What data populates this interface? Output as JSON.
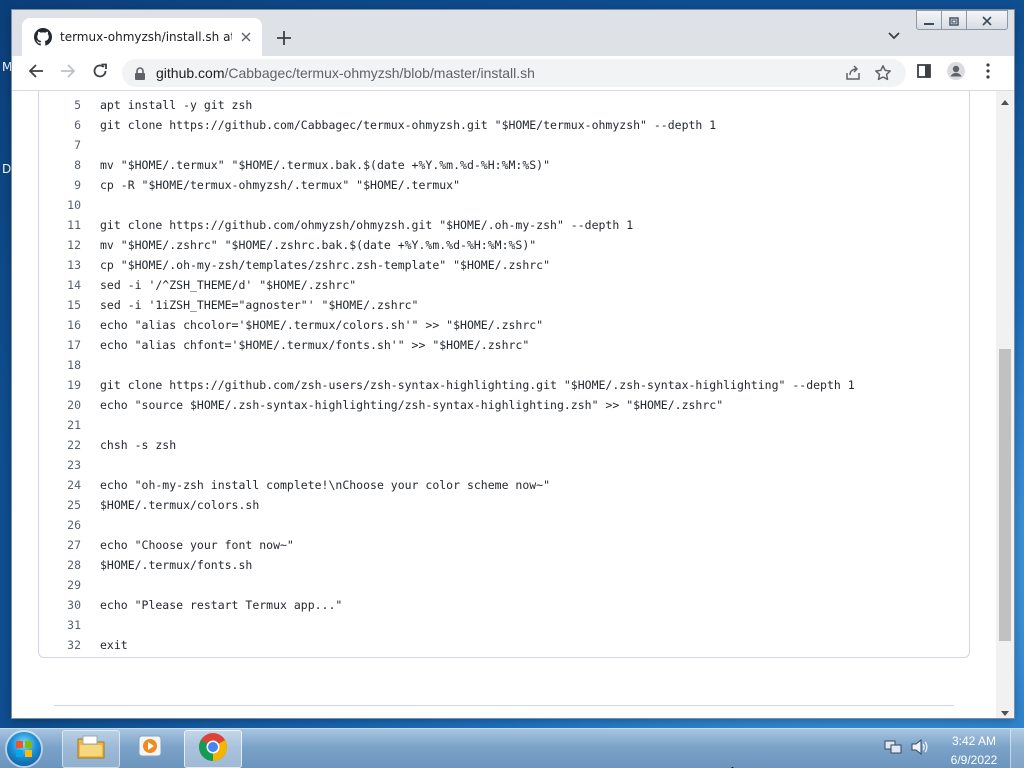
{
  "desktop": {
    "glyph_1": "M",
    "glyph_2": "D"
  },
  "tab": {
    "title": "termux-ohmyzsh/install.sh at ma"
  },
  "window_controls": {
    "minimize": "minimize-icon",
    "maximize": "maximize-icon",
    "close": "close-icon"
  },
  "toolbar": {
    "url_host": "github.com",
    "url_path": "/Cabbagec/termux-ohmyzsh/blob/master/install.sh"
  },
  "code_lines": [
    {
      "n": "5",
      "text": "apt install -y git zsh"
    },
    {
      "n": "6",
      "text": "git clone https://github.com/Cabbagec/termux-ohmyzsh.git \"$HOME/termux-ohmyzsh\" --depth 1"
    },
    {
      "n": "7",
      "text": ""
    },
    {
      "n": "8",
      "text": "mv \"$HOME/.termux\" \"$HOME/.termux.bak.$(date +%Y.%m.%d-%H:%M:%S)\""
    },
    {
      "n": "9",
      "text": "cp -R \"$HOME/termux-ohmyzsh/.termux\" \"$HOME/.termux\""
    },
    {
      "n": "10",
      "text": ""
    },
    {
      "n": "11",
      "text": "git clone https://github.com/ohmyzsh/ohmyzsh.git \"$HOME/.oh-my-zsh\" --depth 1"
    },
    {
      "n": "12",
      "text": "mv \"$HOME/.zshrc\" \"$HOME/.zshrc.bak.$(date +%Y.%m.%d-%H:%M:%S)\""
    },
    {
      "n": "13",
      "text": "cp \"$HOME/.oh-my-zsh/templates/zshrc.zsh-template\" \"$HOME/.zshrc\""
    },
    {
      "n": "14",
      "text": "sed -i '/^ZSH_THEME/d' \"$HOME/.zshrc\""
    },
    {
      "n": "15",
      "text": "sed -i '1iZSH_THEME=\"agnoster\"' \"$HOME/.zshrc\""
    },
    {
      "n": "16",
      "text": "echo \"alias chcolor='$HOME/.termux/colors.sh'\" >> \"$HOME/.zshrc\""
    },
    {
      "n": "17",
      "text": "echo \"alias chfont='$HOME/.termux/fonts.sh'\" >> \"$HOME/.zshrc\""
    },
    {
      "n": "18",
      "text": ""
    },
    {
      "n": "19",
      "text": "git clone https://github.com/zsh-users/zsh-syntax-highlighting.git \"$HOME/.zsh-syntax-highlighting\" --depth 1"
    },
    {
      "n": "20",
      "text": "echo \"source $HOME/.zsh-syntax-highlighting/zsh-syntax-highlighting.zsh\" >> \"$HOME/.zshrc\""
    },
    {
      "n": "21",
      "text": ""
    },
    {
      "n": "22",
      "text": "chsh -s zsh"
    },
    {
      "n": "23",
      "text": ""
    },
    {
      "n": "24",
      "text": "echo \"oh-my-zsh install complete!\\nChoose your color scheme now~\""
    },
    {
      "n": "25",
      "text": "$HOME/.termux/colors.sh"
    },
    {
      "n": "26",
      "text": ""
    },
    {
      "n": "27",
      "text": "echo \"Choose your font now~\""
    },
    {
      "n": "28",
      "text": "$HOME/.termux/fonts.sh"
    },
    {
      "n": "29",
      "text": ""
    },
    {
      "n": "30",
      "text": "echo \"Please restart Termux app...\""
    },
    {
      "n": "31",
      "text": ""
    },
    {
      "n": "32",
      "text": "exit"
    }
  ],
  "taskbar": {
    "time": "3:42 AM",
    "date": "6/9/2022",
    "apps": [
      "windows-explorer",
      "media-player",
      "chrome"
    ]
  },
  "colors": {
    "accent": "#1a73e8",
    "code_text": "#24292f",
    "line_number": "#57606a"
  }
}
